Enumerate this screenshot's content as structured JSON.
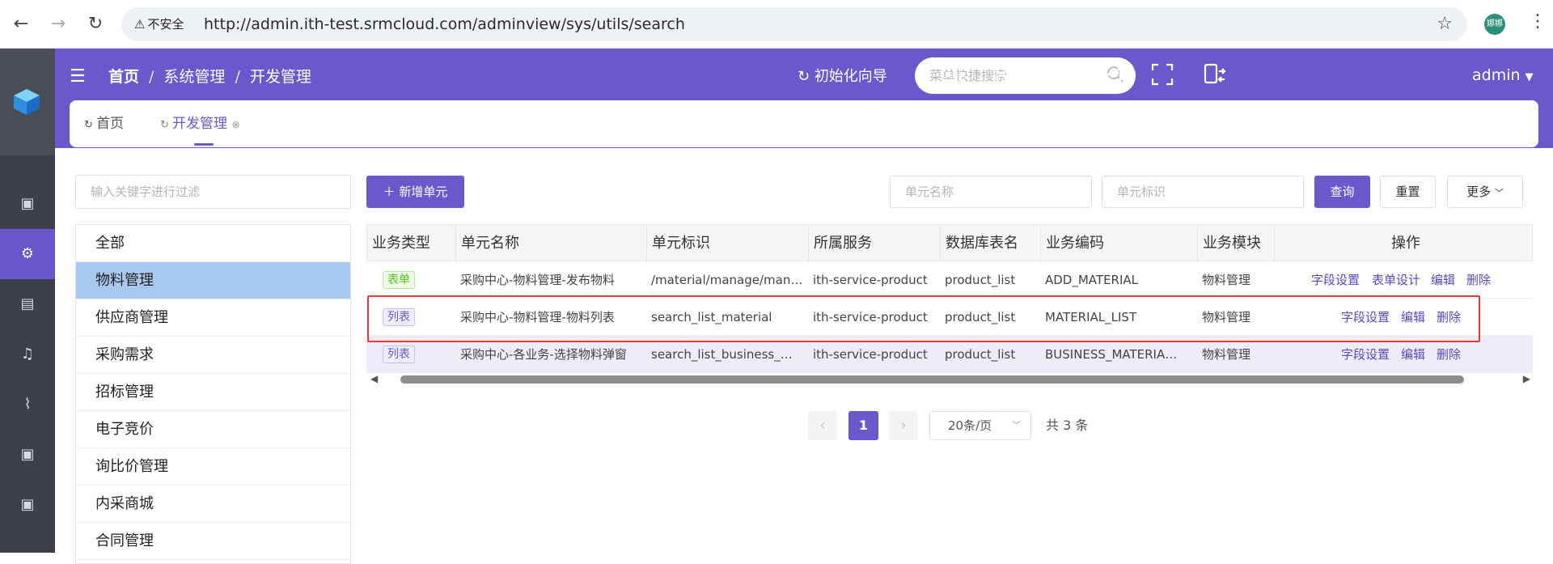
{
  "browser": {
    "back": "←",
    "forward": "→",
    "reload": "↻",
    "security_label": "不安全",
    "url": "http://admin.ith-test.srmcloud.com/adminview/sys/utils/search",
    "profile_initials": "娜娜"
  },
  "header": {
    "breadcrumb": [
      "首页",
      "系统管理",
      "开发管理"
    ],
    "init_wizard": "初始化向导",
    "search_placeholder": "菜单快捷搜索",
    "user": "admin"
  },
  "tabs": [
    {
      "label": "首页"
    },
    {
      "label": "开发管理",
      "active": true
    }
  ],
  "sidebar": {
    "icons": [
      "book-icon",
      "gear-icon",
      "building-icon",
      "bell-icon",
      "paperclip-icon",
      "book-icon",
      "book-icon"
    ],
    "active_index": 1
  },
  "filter": {
    "placeholder": "输入关键字进行过滤"
  },
  "tree": [
    "全部",
    "物料管理",
    "供应商管理",
    "采购需求",
    "招标管理",
    "电子竞价",
    "询比价管理",
    "内采商城",
    "合同管理"
  ],
  "tree_selected_index": 1,
  "toolbar": {
    "add_label": "新增单元",
    "name_placeholder": "单元名称",
    "code_placeholder": "单元标识",
    "query_label": "查询",
    "reset_label": "重置",
    "more_label": "更多"
  },
  "table": {
    "columns": [
      "业务类型",
      "单元名称",
      "单元标识",
      "所属服务",
      "数据库表名",
      "业务编码",
      "业务模块",
      "操作"
    ],
    "rows": [
      {
        "type": "表单",
        "type_kind": "form",
        "name": "采购中心-物料管理-发布物料",
        "code": "/material/manage/man…",
        "service": "ith-service-product",
        "table": "product_list",
        "biz_code": "ADD_MATERIAL",
        "module": "物料管理",
        "actions": [
          "字段设置",
          "表单设计",
          "编辑",
          "删除"
        ]
      },
      {
        "type": "列表",
        "type_kind": "list",
        "name": "采购中心-物料管理-物料列表",
        "code": "search_list_material",
        "service": "ith-service-product",
        "table": "product_list",
        "biz_code": "MATERIAL_LIST",
        "module": "物料管理",
        "actions": [
          "字段设置",
          "编辑",
          "删除"
        ]
      },
      {
        "type": "列表",
        "type_kind": "list",
        "name": "采购中心-各业务-选择物料弹窗",
        "code": "search_list_business_…",
        "service": "ith-service-product",
        "table": "product_list",
        "biz_code": "BUSINESS_MATERIA…",
        "module": "物料管理",
        "actions": [
          "字段设置",
          "编辑",
          "删除"
        ]
      }
    ]
  },
  "pagination": {
    "current": "1",
    "page_size": "20条/页",
    "total": "共 3 条"
  },
  "colors": {
    "primary": "#6c57cc",
    "sidebar": "#3d3f4a",
    "highlight_box": "#e4393c",
    "tree_selected": "#a8c9ef"
  }
}
